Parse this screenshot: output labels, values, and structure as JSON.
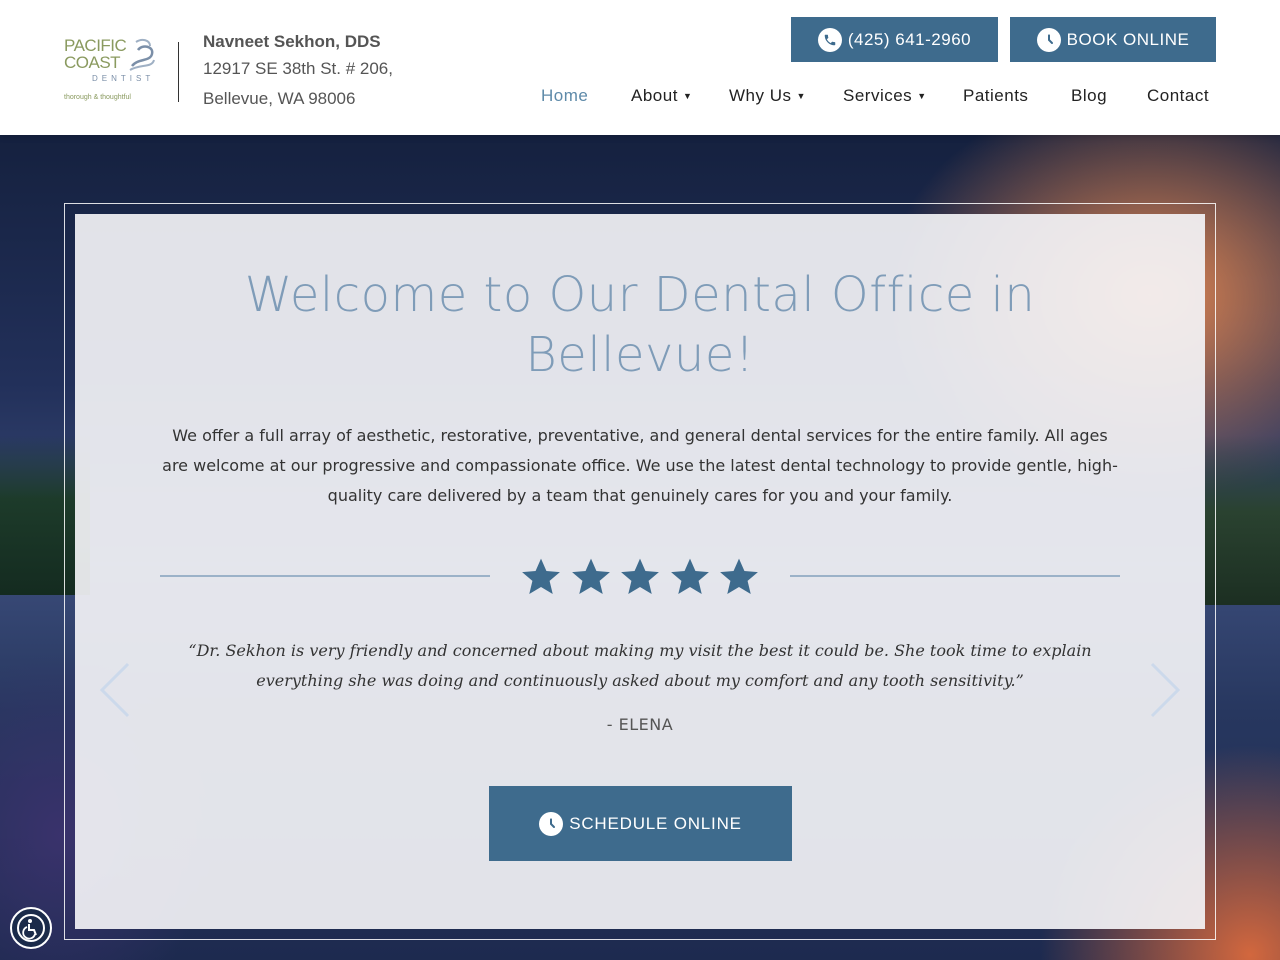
{
  "logo": {
    "line1": "PACIFIC",
    "line2": "COAST",
    "line3": "DENTIST",
    "tagline": "thorough & thoughtful"
  },
  "practice": {
    "name": "Navneet Sekhon, DDS",
    "address_line1": "12917 SE 38th St. # 206,",
    "address_line2": "Bellevue, WA 98006"
  },
  "header_buttons": {
    "phone_label": "(425) 641-2960",
    "book_label": "BOOK ONLINE"
  },
  "nav": {
    "items": [
      {
        "label": "Home"
      },
      {
        "label": "About"
      },
      {
        "label": "Why Us"
      },
      {
        "label": "Services"
      },
      {
        "label": "Patients"
      },
      {
        "label": "Blog"
      },
      {
        "label": "Contact"
      }
    ]
  },
  "hero": {
    "title_line1": "Welcome to Our Dental Office in",
    "title_line2": "Bellevue!",
    "body": "We offer a full array of aesthetic, restorative, preventative, and general dental services for the entire family. All ages are welcome at our progressive and compassionate office. We use the latest dental technology to provide gentle, high-quality care delivered by a team that genuinely cares for you and your family.",
    "rating": 5,
    "testimonial": "“Dr. Sekhon is very friendly and concerned about making my visit the best it could be. She took time to explain everything she was doing and continuously asked about my comfort and any tooth sensitivity.”",
    "author": "- ELENA",
    "schedule_label": "SCHEDULE ONLINE"
  },
  "icons": {
    "phone": "phone-icon",
    "clock": "clock-icon",
    "star": "star-icon",
    "prev": "chevron-left-icon",
    "next": "chevron-right-icon",
    "accessibility": "accessibility-icon"
  },
  "colors": {
    "accent": "#3e6b8d",
    "title": "#7f9cb8",
    "nav_active": "#5e8aa9"
  }
}
